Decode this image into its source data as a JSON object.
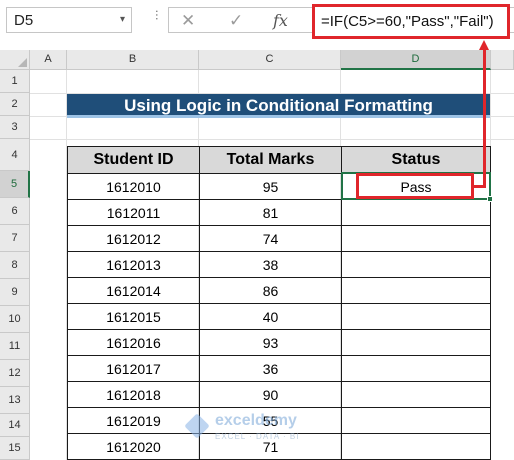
{
  "formula_bar": {
    "name_box": "D5",
    "name_box_arrow": "▾",
    "cancel_icon": "✕",
    "enter_icon": "✓",
    "fx_icon": "fx",
    "formula": "=IF(C5>=60,\"Pass\",\"Fail\")"
  },
  "columns": [
    "A",
    "B",
    "C",
    "D"
  ],
  "selected_column": "D",
  "rows": [
    "1",
    "2",
    "3",
    "4",
    "5",
    "6",
    "7",
    "8",
    "9",
    "10",
    "11",
    "12",
    "13",
    "14",
    "15"
  ],
  "selected_row": "5",
  "title": "Using Logic in Conditional Formatting",
  "table": {
    "headers": [
      "Student ID",
      "Total Marks",
      "Status"
    ],
    "rows": [
      [
        "1612010",
        "95",
        "Pass"
      ],
      [
        "1612011",
        "81",
        ""
      ],
      [
        "1612012",
        "74",
        ""
      ],
      [
        "1612013",
        "38",
        ""
      ],
      [
        "1612014",
        "86",
        ""
      ],
      [
        "1612015",
        "40",
        ""
      ],
      [
        "1612016",
        "93",
        ""
      ],
      [
        "1612017",
        "36",
        ""
      ],
      [
        "1612018",
        "90",
        ""
      ],
      [
        "1612019",
        "55",
        ""
      ],
      [
        "1612020",
        "71",
        ""
      ]
    ]
  },
  "watermark": {
    "name": "exceldemy",
    "tagline": "EXCEL · DATA · BI"
  },
  "colors": {
    "title_bg": "#1f4e79",
    "header_bg": "#d9d9d9",
    "highlight_red": "#e0262b",
    "selection_green": "#217346"
  }
}
